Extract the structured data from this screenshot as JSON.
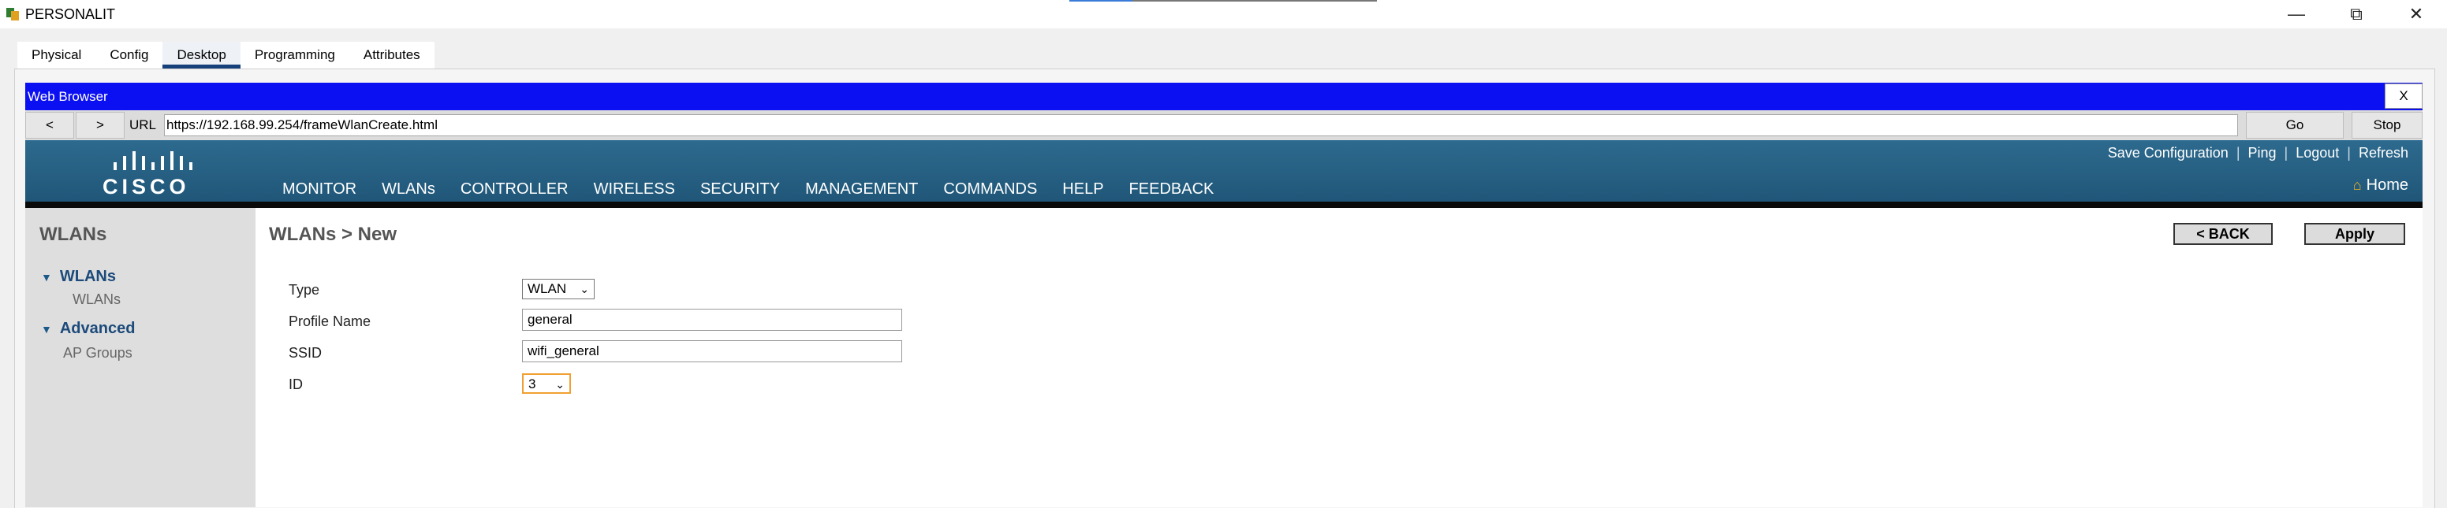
{
  "window": {
    "title": "PERSONALIT",
    "min_icon": "minimize-icon",
    "restore_icon": "restore-icon",
    "close_icon": "close-icon"
  },
  "tabs": [
    {
      "label": "Physical"
    },
    {
      "label": "Config"
    },
    {
      "label": "Desktop"
    },
    {
      "label": "Programming"
    },
    {
      "label": "Attributes"
    }
  ],
  "web_browser": {
    "title": "Web Browser",
    "close_label": "X",
    "back_label": "<",
    "forward_label": ">",
    "url_label": "URL",
    "url": "https://192.168.99.254/frameWlanCreate.html",
    "go_label": "Go",
    "stop_label": "Stop"
  },
  "cisco": {
    "logo_text": "CISCO",
    "nav": [
      {
        "label": "MONITOR"
      },
      {
        "label": "WLANs"
      },
      {
        "label": "CONTROLLER"
      },
      {
        "label": "WIRELESS"
      },
      {
        "label": "SECURITY"
      },
      {
        "label": "MANAGEMENT"
      },
      {
        "label": "COMMANDS"
      },
      {
        "label": "HELP"
      },
      {
        "label": "FEEDBACK"
      }
    ],
    "utils": {
      "save": "Save Configuration",
      "ping": "Ping",
      "logout": "Logout",
      "refresh": "Refresh",
      "sep": "|"
    },
    "home": "Home"
  },
  "sidebar": {
    "title": "WLANs",
    "groups": [
      {
        "label": "WLANs",
        "sub": "WLANs"
      },
      {
        "label": "Advanced",
        "sub": "AP Groups"
      }
    ]
  },
  "main": {
    "title": "WLANs > New",
    "back_button": "< BACK",
    "apply_button": "Apply",
    "form": {
      "type_label": "Type",
      "type_value": "WLAN",
      "profile_label": "Profile Name",
      "profile_value": "general",
      "ssid_label": "SSID",
      "ssid_value": "wifi_general",
      "id_label": "ID",
      "id_value": "3"
    }
  },
  "colors": {
    "browser_bar": "#0b10f2",
    "cisco_header": "#2d6a8e",
    "active_nav_underline": "#f29a1f",
    "active_tab_underline": "#16407a"
  }
}
